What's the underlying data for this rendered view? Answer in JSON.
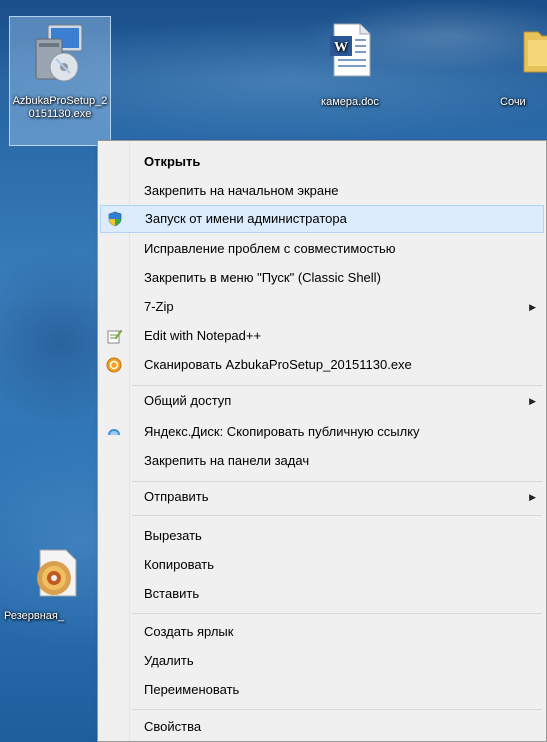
{
  "desktop": {
    "icons": [
      {
        "label": "AzbukaProSetup_20151130.exe",
        "icon": "installer-icon",
        "selected": true
      },
      {
        "label": "камера.doc",
        "icon": "word-document-icon"
      },
      {
        "label": "Сочи",
        "icon": "folder-icon"
      },
      {
        "label": "Резервная_",
        "icon": "backup-disc-icon"
      }
    ]
  },
  "context_menu": {
    "groups": [
      [
        {
          "label": "Открыть",
          "bold": true
        },
        {
          "label": "Закрепить на начальном экране"
        },
        {
          "label": "Запуск от имени администратора",
          "icon": "uac-shield-icon",
          "highlighted": true
        },
        {
          "label": "Исправление проблем с совместимостью"
        },
        {
          "label": "Закрепить в меню \"Пуск\" (Classic Shell)"
        },
        {
          "label": "7-Zip",
          "submenu": true
        },
        {
          "label": "Edit with Notepad++",
          "icon": "notepad-plus-icon"
        },
        {
          "label": "Сканировать AzbukaProSetup_20151130.exe",
          "icon": "antivirus-scan-icon"
        }
      ],
      [
        {
          "label": "Общий доступ",
          "submenu": true
        },
        {
          "label": "Яндекс.Диск: Скопировать публичную ссылку",
          "icon": "yandex-disk-icon"
        },
        {
          "label": "Закрепить на панели задач"
        }
      ],
      [
        {
          "label": "Отправить",
          "submenu": true
        }
      ],
      [
        {
          "label": "Вырезать"
        },
        {
          "label": "Копировать"
        },
        {
          "label": "Вставить"
        }
      ],
      [
        {
          "label": "Создать ярлык"
        },
        {
          "label": "Удалить"
        },
        {
          "label": "Переименовать"
        }
      ],
      [
        {
          "label": "Свойства"
        }
      ]
    ],
    "submenu_arrow": "▶"
  }
}
